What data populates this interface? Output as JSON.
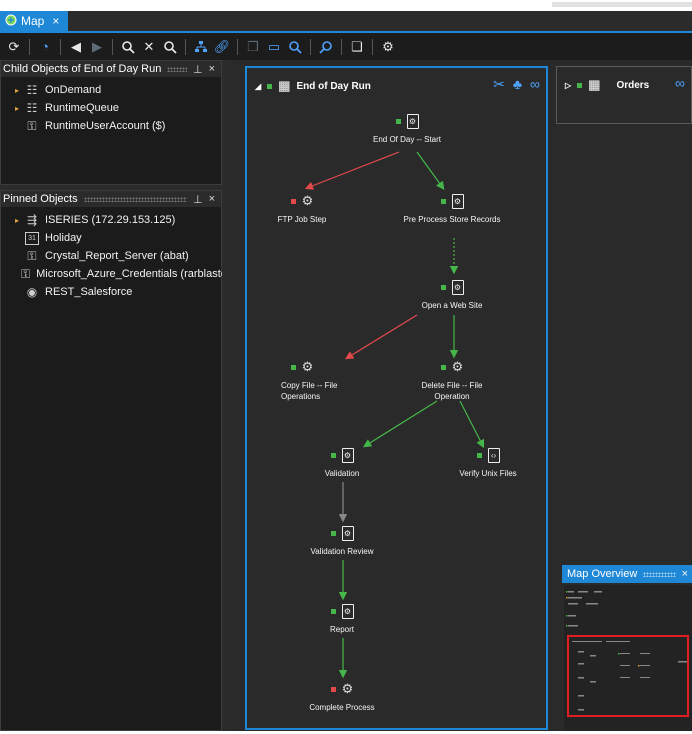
{
  "tab": {
    "title": "Map",
    "close": "×"
  },
  "toolbar": {
    "icons": [
      "refresh-icon",
      "history-icon",
      "back-icon",
      "forward-icon",
      "zoom-in-icon",
      "fit-icon",
      "zoom-out-icon",
      "hierarchy-icon",
      "link-icon",
      "copy-icon",
      "monitor-icon",
      "search-screen-icon",
      "find-icon",
      "pages-icon",
      "settings-icon"
    ]
  },
  "child_panel": {
    "title": "Child Objects of End of Day Run",
    "pin": "⊥",
    "close": "×",
    "items": [
      {
        "label": "OnDemand"
      },
      {
        "label": "RuntimeQueue"
      },
      {
        "label": "RuntimeUserAccount ($)"
      }
    ]
  },
  "pinned_panel": {
    "title": "Pinned Objects",
    "pin": "⊥",
    "close": "×",
    "items": [
      {
        "label": "ISERIES (172.29.153.125)"
      },
      {
        "label": "Holiday",
        "icon_text": "31"
      },
      {
        "label": "Crystal_Report_Server (abat)"
      },
      {
        "label": "Microsoft_Azure_Credentials (rarblaste"
      },
      {
        "label": "REST_Salesforce"
      }
    ]
  },
  "workflow": {
    "title": "End of Day Run",
    "nodes": [
      {
        "label": "End Of Day -- Start",
        "status": "green",
        "icon": "document-gear-icon"
      },
      {
        "label": "FTP Job Step",
        "status": "red",
        "icon": "gears-icon"
      },
      {
        "label": "Pre Process Store Records",
        "status": "green",
        "icon": "document-gear-icon"
      },
      {
        "label": "Open a Web Site",
        "status": "green",
        "icon": "document-gear-icon"
      },
      {
        "label": "Copy File -- File Operations",
        "status": "green",
        "icon": "gears-icon"
      },
      {
        "label": "Delete File -- File Operation",
        "status": "green",
        "icon": "gears-icon"
      },
      {
        "label": "Validation",
        "status": "green",
        "icon": "document-gear-icon"
      },
      {
        "label": "Verify Unix Files",
        "status": "green",
        "icon": "script-icon"
      },
      {
        "label": "Validation Review",
        "status": "green",
        "icon": "document-gear-icon"
      },
      {
        "label": "Report",
        "status": "green",
        "icon": "document-gear-icon"
      },
      {
        "label": "Complete Process",
        "status": "red",
        "icon": "gears-icon"
      }
    ]
  },
  "orders": {
    "title": "Orders"
  },
  "overview": {
    "title": "Map Overview",
    "close": "×"
  },
  "colors": {
    "accent": "#1e87d6",
    "success": "#45b649",
    "failure": "#e2494d"
  }
}
